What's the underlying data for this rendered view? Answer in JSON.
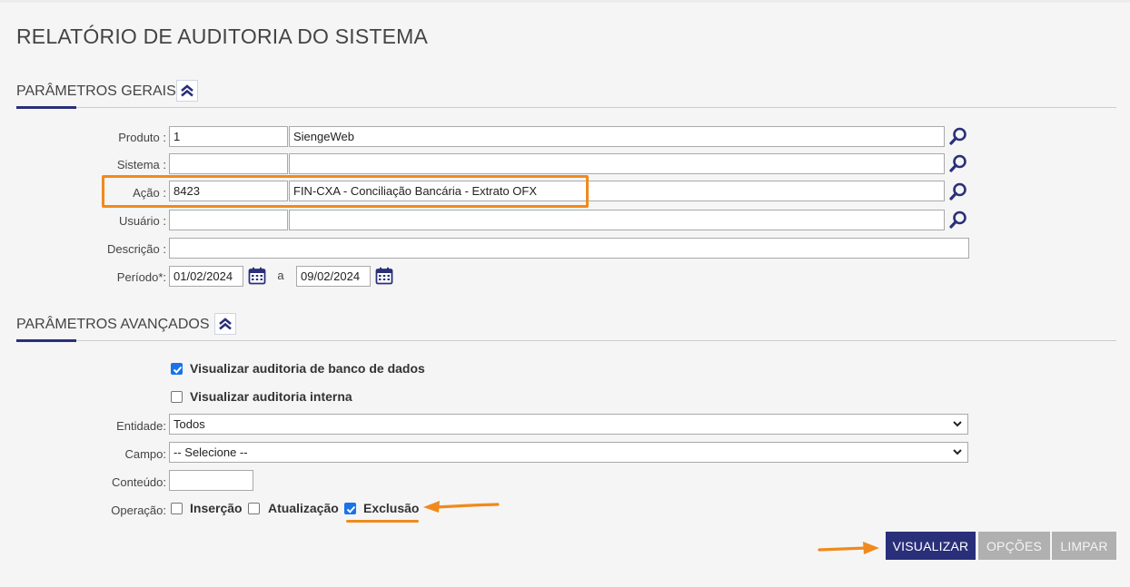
{
  "page": {
    "title": "RELATÓRIO DE AUDITORIA DO SISTEMA"
  },
  "general": {
    "title": "PARÂMETROS GERAIS",
    "collapse_icon": "double-chevron-up-icon",
    "produto": {
      "label": "Produto :",
      "code": "1",
      "description": "SiengeWeb"
    },
    "sistema": {
      "label": "Sistema :",
      "code": "",
      "description": ""
    },
    "acao": {
      "label": "Ação :",
      "code": "8423",
      "description": "FIN-CXA - Conciliação Bancária - Extrato OFX"
    },
    "usuario": {
      "label": "Usuário :",
      "code": "",
      "description": ""
    },
    "descricao": {
      "label": "Descrição :",
      "value": ""
    },
    "periodo": {
      "label": "Período*:",
      "from": "01/02/2024",
      "separator": "a",
      "to": "09/02/2024"
    }
  },
  "advanced": {
    "title": "PARÂMETROS AVANÇADOS",
    "collapse_icon": "double-chevron-up-icon",
    "db_audit": {
      "label": "Visualizar auditoria de banco de dados",
      "checked": true
    },
    "internal_audit": {
      "label": "Visualizar auditoria interna",
      "checked": false
    },
    "entidade": {
      "label": "Entidade:",
      "value": "Todos"
    },
    "campo": {
      "label": "Campo:",
      "value": "-- Selecione --"
    },
    "conteudo": {
      "label": "Conteúdo:",
      "value": ""
    },
    "operacao": {
      "label": "Operação:",
      "insercao": {
        "label": "Inserção",
        "checked": false
      },
      "atualizacao": {
        "label": "Atualização",
        "checked": false
      },
      "exclusao": {
        "label": "Exclusão",
        "checked": true
      }
    }
  },
  "actions": {
    "visualizar": "VISUALIZAR",
    "opcoes": "OPÇÕES",
    "limpar": "LIMPAR"
  },
  "colors": {
    "accent": "#2a2f7a",
    "annotation": "#f08a1c",
    "checkbox": "#1a73e8",
    "disabled": "#b0b0b0"
  }
}
